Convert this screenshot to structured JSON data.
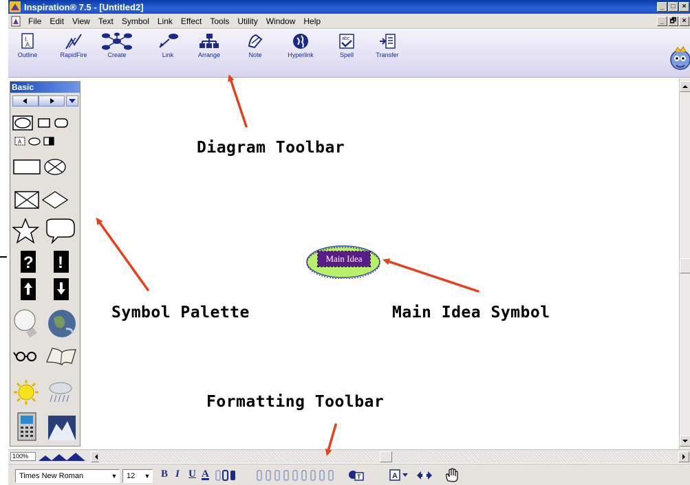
{
  "window": {
    "title": "Inspiration® 7.5 - [Untitled2]",
    "controls": [
      "_",
      "□",
      "×"
    ],
    "mdi_controls": [
      "_",
      "🗗",
      "×"
    ]
  },
  "menubar": {
    "items": [
      "File",
      "Edit",
      "View",
      "Text",
      "Symbol",
      "Link",
      "Effect",
      "Tools",
      "Utility",
      "Window",
      "Help"
    ]
  },
  "diagram_toolbar": {
    "buttons": [
      {
        "label": "Outline",
        "icon": "outline-icon"
      },
      {
        "label": "RapidFire",
        "icon": "rapidfire-icon"
      },
      {
        "label": "Create",
        "icon": "create-icon"
      },
      {
        "label": "Link",
        "icon": "link-icon"
      },
      {
        "label": "Arrange",
        "icon": "arrange-icon"
      },
      {
        "label": "Note",
        "icon": "note-icon"
      },
      {
        "label": "Hyperlink",
        "icon": "hyperlink-icon"
      },
      {
        "label": "Spell",
        "icon": "spell-icon"
      },
      {
        "label": "Transfer",
        "icon": "transfer-icon"
      }
    ]
  },
  "symbol_palette": {
    "title": "Basic",
    "symbols": [
      "oval",
      "rectangle",
      "rounded-rectangle",
      "labeled-rect",
      "small-oval",
      "half-filled-rect",
      "wide-rectangle",
      "crossed-oval",
      "crossed-rectangle",
      "diamond",
      "star",
      "speech-bubble",
      "question-mark",
      "exclamation-mark",
      "up-arrow",
      "down-arrow",
      "lightbulb",
      "globe",
      "glasses",
      "book",
      "sun",
      "rain-cloud",
      "calculator",
      "mountains"
    ]
  },
  "canvas": {
    "main_idea": {
      "label": "Main Idea",
      "fill": "#b8f06a",
      "label_bg": "#5b1c8a"
    }
  },
  "status": {
    "zoom": "100%"
  },
  "format_toolbar": {
    "font": "Times New Roman",
    "size": "12",
    "bold": "B",
    "italic": "I",
    "underline": "U",
    "text_color": "A"
  },
  "annotations": {
    "diagram_toolbar": "Diagram Toolbar",
    "symbol_palette": "Symbol Palette",
    "main_idea_symbol": "Main Idea Symbol",
    "formatting_toolbar": "Formatting Toolbar",
    "arrow_color": "#e8401c"
  }
}
